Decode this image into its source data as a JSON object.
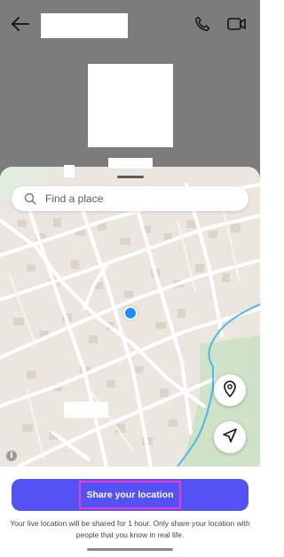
{
  "header": {
    "back_icon": "arrow-left-icon",
    "call_icon": "phone-icon",
    "video_icon": "video-camera-icon"
  },
  "search": {
    "placeholder": "Find a place",
    "icon": "search-icon"
  },
  "map": {
    "location_dot_color": "#1b8ff5",
    "recenter_icon": "map-pin-icon",
    "navigate_icon": "navigation-arrow-icon",
    "info_symbol": "i"
  },
  "share": {
    "button_label": "Share your location",
    "button_color": "#5452f5",
    "highlight_color": "#e63ec7"
  },
  "disclaimer": "Your live location will be shared for 1 hour. Only share your location with people that you know in real life."
}
